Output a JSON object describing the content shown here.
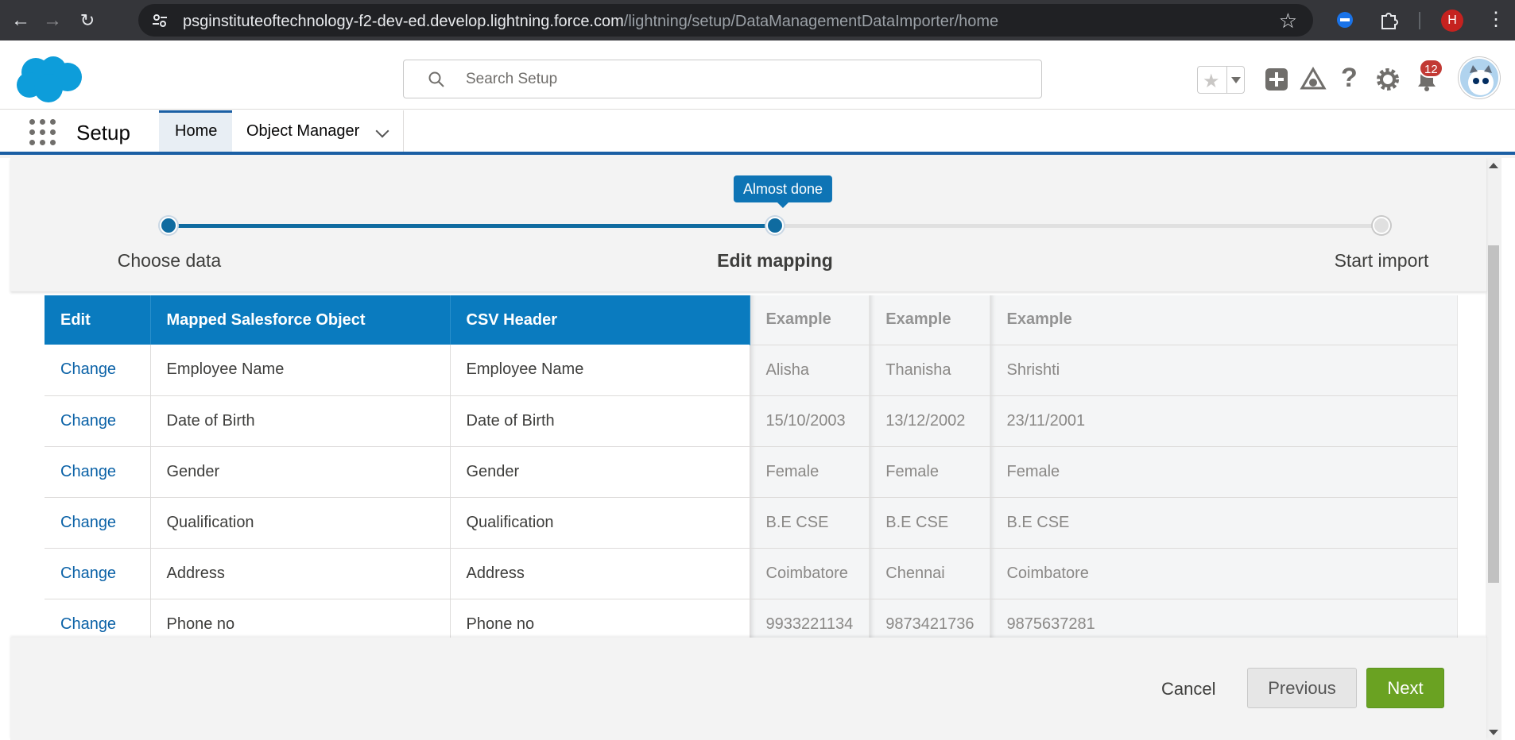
{
  "browser": {
    "url_host": "psginstituteoftechnology-f2-dev-ed.develop.lightning.force.com",
    "url_path": "/lightning/setup/DataManagementDataImporter/home",
    "profile_initial": "H"
  },
  "header": {
    "search_placeholder": "Search Setup",
    "notification_count": "12"
  },
  "context": {
    "app_name": "Setup",
    "tabs": [
      {
        "label": "Home",
        "active": true
      },
      {
        "label": "Object Manager",
        "active": false
      }
    ]
  },
  "progress": {
    "tooltip": "Almost done",
    "steps": [
      {
        "label": "Choose data",
        "state": "complete"
      },
      {
        "label": "Edit mapping",
        "state": "current"
      },
      {
        "label": "Start import",
        "state": "incomplete"
      }
    ],
    "fill_fraction": 0.5
  },
  "table": {
    "headers": [
      "Edit",
      "Mapped Salesforce Object",
      "CSV Header",
      "Example",
      "Example",
      "Example"
    ],
    "rows": [
      {
        "edit": "Change",
        "object": "Employee Name",
        "csv": "Employee Name",
        "ex1": "Alisha",
        "ex2": "Thanisha",
        "ex3": "Shrishti"
      },
      {
        "edit": "Change",
        "object": "Date of Birth",
        "csv": "Date of Birth",
        "ex1": "15/10/2003",
        "ex2": "13/12/2002",
        "ex3": "23/11/2001"
      },
      {
        "edit": "Change",
        "object": "Gender",
        "csv": "Gender",
        "ex1": "Female",
        "ex2": "Female",
        "ex3": "Female"
      },
      {
        "edit": "Change",
        "object": "Qualification",
        "csv": "Qualification",
        "ex1": "B.E CSE",
        "ex2": "B.E CSE",
        "ex3": "B.E CSE"
      },
      {
        "edit": "Change",
        "object": "Address",
        "csv": "Address",
        "ex1": "Coimbatore",
        "ex2": "Chennai",
        "ex3": "Coimbatore"
      },
      {
        "edit": "Change",
        "object": "Phone no",
        "csv": "Phone no",
        "ex1": "9933221134",
        "ex2": "9873421736",
        "ex3": "9875637281"
      }
    ]
  },
  "footer": {
    "cancel_label": "Cancel",
    "previous_label": "Previous",
    "next_label": "Next"
  },
  "colors": {
    "brand_blue": "#0a7bbf",
    "progress_blue": "#0f6ba0",
    "next_green": "#6aa222"
  }
}
